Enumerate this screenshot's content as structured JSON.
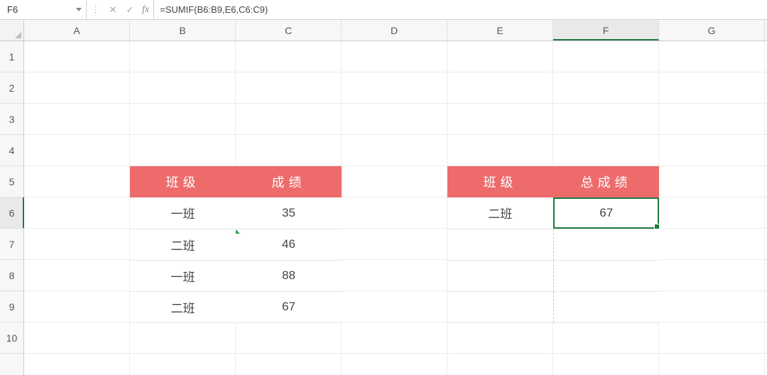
{
  "formula_bar": {
    "namebox": "F6",
    "formula": "=SUMIF(B6:B9,E6,C6:C9)"
  },
  "columns": [
    "A",
    "B",
    "C",
    "D",
    "E",
    "F",
    "G"
  ],
  "rows": [
    "1",
    "2",
    "3",
    "4",
    "5",
    "6",
    "7",
    "8",
    "9",
    "10"
  ],
  "col_selected_index": 5,
  "row_selected_index": 5,
  "table_left": {
    "headers": {
      "col1": "班级",
      "col2": "成绩"
    },
    "rows": [
      {
        "col1": "一班",
        "col2": "35"
      },
      {
        "col1": "二班",
        "col2": "46"
      },
      {
        "col1": "一班",
        "col2": "88"
      },
      {
        "col1": "二班",
        "col2": "67"
      }
    ]
  },
  "table_right": {
    "headers": {
      "col1": "班级",
      "col2": "总成绩"
    },
    "rows": [
      {
        "col1": "二班",
        "col2": "67"
      },
      {
        "col1": "",
        "col2": ""
      },
      {
        "col1": "",
        "col2": ""
      },
      {
        "col1": "",
        "col2": ""
      }
    ]
  },
  "icons": {
    "cancel": "✕",
    "confirm": "✓",
    "fx": "fx"
  }
}
